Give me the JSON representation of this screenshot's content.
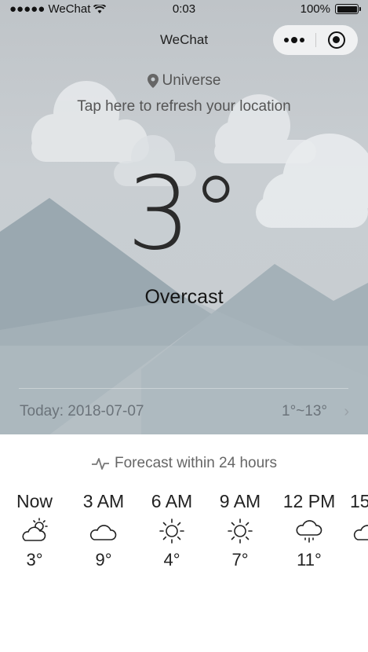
{
  "status_bar": {
    "carrier": "●●●●● WeChat",
    "time": "0:03",
    "battery": "100%"
  },
  "nav": {
    "title": "WeChat"
  },
  "location": {
    "name": "Universe",
    "hint": "Tap here to refresh your location"
  },
  "current": {
    "temperature": "3°",
    "condition": "Overcast"
  },
  "today": {
    "label": "Today: 2018-07-07",
    "range": "1°~13°",
    "arrow": "›"
  },
  "forecast": {
    "title": "Forecast within 24 hours",
    "hours": [
      {
        "time": "Now",
        "icon": "cloudy-sun-icon",
        "temp": "3°"
      },
      {
        "time": "3 AM",
        "icon": "cloud-icon",
        "temp": "9°"
      },
      {
        "time": "6 AM",
        "icon": "sun-icon",
        "temp": "4°"
      },
      {
        "time": "9 AM",
        "icon": "sun-icon",
        "temp": "7°"
      },
      {
        "time": "12 PM",
        "icon": "rain-cloud-icon",
        "temp": "11°"
      },
      {
        "time": "15",
        "icon": "cloud-icon",
        "temp": ""
      }
    ]
  }
}
